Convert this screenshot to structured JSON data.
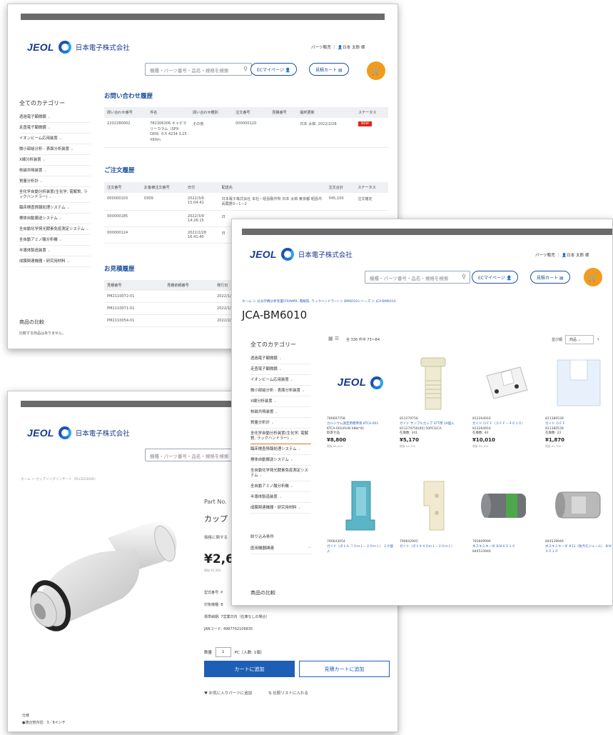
{
  "brand": {
    "logo_text": "JEOL",
    "company": "日本電子株式会社"
  },
  "window1": {
    "header": {
      "parts_sales": "パーツ販売",
      "user": "日本 太郎 様",
      "search_placeholder": "機種・パーツ番号・品名・規格を検索",
      "ec_mypage": "ECマイページ",
      "quote_cart": "見積カート"
    },
    "sidebar": {
      "title": "全てのカテゴリー",
      "items": [
        "透過電子顕微鏡",
        "走査電子顕微鏡",
        "イオンビーム応用装置",
        "微小部組分析 - 表面分析装置",
        "X線分析装置",
        "核磁共鳴装置",
        "質量分析計",
        "全化学自動分析装置(生化学, 電解質, ラックハンドラー)",
        "臨床検査情報処理システム",
        "検体自動搬送システム",
        "全自動化学発光酵素免疫測定システム",
        "全自動アミノ酸分析機",
        "半導体製造装置",
        "成膜関連機器・研究用材料"
      ],
      "compare_title": "商品の比較",
      "compare_text": "比較する商品はありません。"
    },
    "inquiry": {
      "title": "お問い合わせ履歴",
      "headers": [
        "問い合わせ番号",
        "件名",
        "問い合わせ種別",
        "注文番号",
        "見積番号",
        "最終更新",
        "ステータス"
      ],
      "row": {
        "id": "2202280002",
        "subject": "782306306 キャピラリーカラム（SPX-OXN）0.5 4234 3.25 X60m",
        "type": "その他",
        "order": "000000120",
        "quote": "",
        "updated": "日本 太郎, 2022/2/28",
        "status": "NEW"
      }
    },
    "orders": {
      "title": "ご注文履歴",
      "headers": [
        "注文番号",
        "お客様注文番号",
        "日付",
        "配送先",
        "注文合計",
        "ステータス"
      ],
      "rows": [
        {
          "id": "000000103",
          "cust": "0309",
          "date": "2022/3/9",
          "time": "15:04:41",
          "ship": "日本電子株式会社 本社・昭島製作所 日本 太郎 東京都 昭島市武蔵野3－1－2",
          "total": "¥45,100",
          "status": "注文確定"
        },
        {
          "id": "000000185",
          "cust": "",
          "date": "2022/3/9",
          "time": "14:26:15",
          "ship": "日",
          "total": "",
          "status": ""
        },
        {
          "id": "000000124",
          "cust": "",
          "date": "2022/2/28",
          "time": "16:41:40",
          "ship": "日",
          "total": "",
          "status": ""
        }
      ]
    },
    "quotes": {
      "title": "お見積履歴",
      "headers": [
        "見積番号",
        "見積依頼番号",
        "発行日"
      ],
      "rows": [
        {
          "id": "PM2110072-01",
          "date": "2022/1/6"
        },
        {
          "id": "PM2110071-01",
          "date": "2022/1/6"
        },
        {
          "id": "PM2110054-01",
          "date": "2022/2/2"
        }
      ]
    }
  },
  "window2": {
    "search_placeholder": "機種・パーツ番号・品名・規格を検索",
    "breadcrumb": "ホーム ＞ カップリングインサート（PLCD23006）",
    "part_no_label": "Part No.",
    "product_name_partial": "カップ",
    "price_note": "価格に関する",
    "price": "¥2,6",
    "price_sub": "税抜 ¥2,400",
    "specs": [
      "型式番号: P",
      "対象機種: B",
      "標準納期: 7営業日内（在庫なしの場合）",
      "JANコード: 4987762106835"
    ],
    "qty_label": "数量",
    "qty_value": "1",
    "qty_unit": "PC（入数: 1個）",
    "add_to_cart": "カートに追加",
    "add_to_quote": "見積カートに追加",
    "favorite": "お気に入りパーツに追加",
    "compare": "比較リストに入れる",
    "bottom_label": "仕様",
    "bottom_spec": "●適合管内径：3／8インチ"
  },
  "window3": {
    "header": {
      "parts_sales": "パーツ販売",
      "user": "日本 太郎 様",
      "search_placeholder": "機種・パーツ番号・品名・規格を検索",
      "ec_mypage": "ECマイページ",
      "quote_cart": "見積カート"
    },
    "breadcrumb": "ホーム ＞ 分光学機分析装置(FR/NMR, 電解質, ラックハンドラー) ＞ BM6010シリーズ ＞ JCA-BM6010",
    "title": "JCA-BM6010",
    "count_text": "全 336 件中 73～84",
    "sort_label": "並び順",
    "sort_value": "商品",
    "sidebar": {
      "title": "全てのカテゴリー",
      "items": [
        "透過電子顕微鏡",
        "走査電子顕微鏡",
        "イオンビーム応用装置",
        "微小部組分析 - 表面分析装置",
        "X線分析装置",
        "核磁共鳴装置",
        "質量分析計",
        "全化学自動分析装置(生化学, 電解質, ラックハンドラー)",
        "臨床検査情報処理システム",
        "検体自動搬送システム",
        "全自動化学発光酵素免疫測定システム",
        "全自動アミノ酸分析機",
        "半導体製造装置",
        "成膜関連機器・研究用材料"
      ],
      "filter_title": "絞り込み条件",
      "filter_group": "医用機器関連",
      "compare_title": "商品の比較"
    },
    "products": [
      {
        "code": "780697758",
        "name": "カルシウム測定用標準液 KTCA-001",
        "sub": "KTCA-001(RUN X8bt*8)",
        "lead": "取寄せ品",
        "price": "¥8,800",
        "tax": "税抜 ¥8,000"
      },
      {
        "code": "811279756",
        "name": "ガイド サンプルカップ STT用 10個入",
        "sub": "811279756(00) 50PCS/CA",
        "lead": "在庫数: 341",
        "price": "¥5,170",
        "tax": "税抜 ¥4,700"
      },
      {
        "code": "812264916",
        "name": "ガイド ＯＦＦ（ＳＦＦ－４０１０）",
        "sub": "812264916",
        "lead": "在庫数: 44",
        "price": "¥10,010",
        "tax": "税抜 ¥9,100"
      },
      {
        "code": "811380539",
        "name": "ガイド ＯＦＦ",
        "sub": "811380539",
        "lead": "在庫数: 23",
        "price": "¥1,870",
        "tax": "税抜 ¥1,700"
      },
      {
        "code": "790643054",
        "name": "ガイド（ボトル ７０ｍｌ－２０ｍｌ） ２０個入",
        "sub": "",
        "lead": "",
        "price": "",
        "tax": ""
      },
      {
        "code": "790642945",
        "name": "ガイド（ボトル４０ｍｌ－２０ｍｌ）",
        "sub": "",
        "lead": "",
        "price": "",
        "tax": ""
      },
      {
        "code": "783609996",
        "name": "水スキミキーダ ＢＭ６０１０",
        "sub": "844533946",
        "lead": "",
        "price": "",
        "tax": ""
      },
      {
        "code": "844539946",
        "name": "水スキミキーダ #11（防汚モジュール） ＢＭ６０１０",
        "sub": "",
        "lead": "",
        "price": "",
        "tax": ""
      }
    ]
  }
}
